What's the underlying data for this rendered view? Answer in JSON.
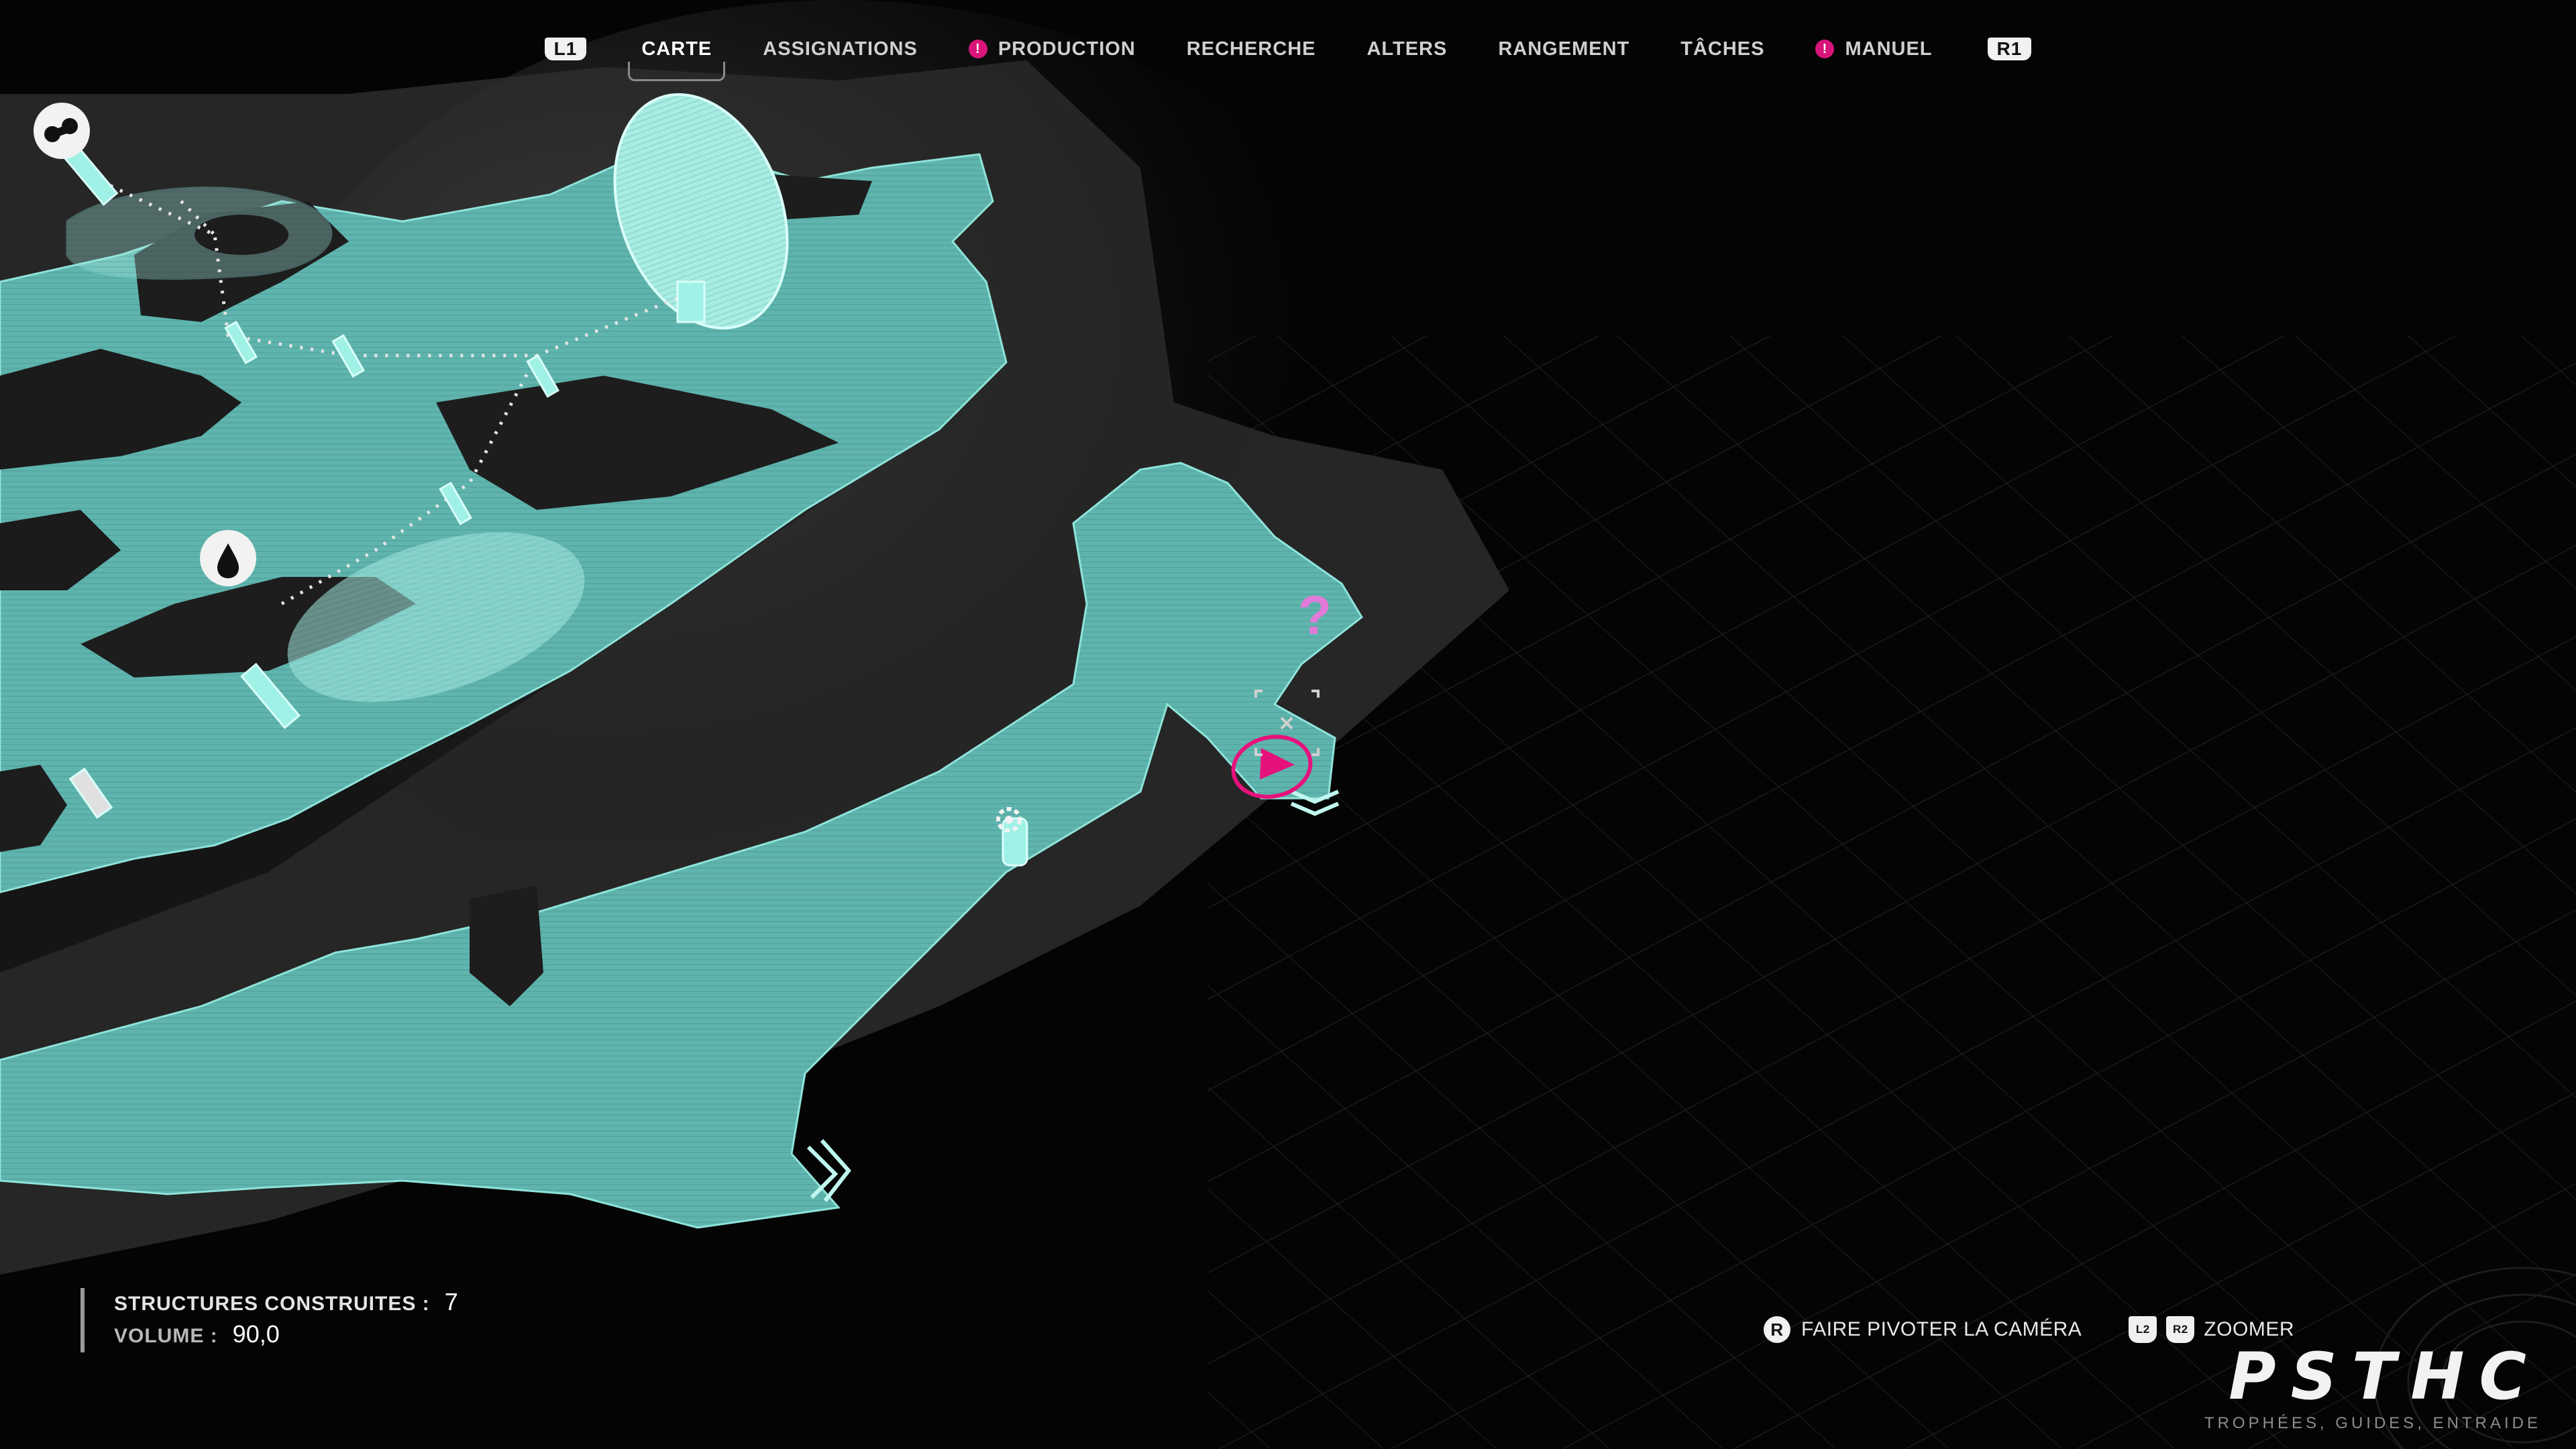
{
  "nav": {
    "left_button": "L1",
    "right_button": "R1",
    "tabs": [
      {
        "label": "CARTE",
        "active": true,
        "alert": false
      },
      {
        "label": "ASSIGNATIONS",
        "active": false,
        "alert": false
      },
      {
        "label": "PRODUCTION",
        "active": false,
        "alert": true
      },
      {
        "label": "RECHERCHE",
        "active": false,
        "alert": false
      },
      {
        "label": "ALTERS",
        "active": false,
        "alert": false
      },
      {
        "label": "RANGEMENT",
        "active": false,
        "alert": false
      },
      {
        "label": "TÂCHES",
        "active": false,
        "alert": false
      },
      {
        "label": "MANUEL",
        "active": false,
        "alert": true
      }
    ],
    "alert_glyph": "!"
  },
  "stats": {
    "structures_label": "STRUCTURES CONSTRUITES :",
    "structures_value": "7",
    "volume_label": "VOLUME :",
    "volume_value": "90,0"
  },
  "controls": {
    "rotate_button": "R",
    "rotate_label": "FAIRE PIVOTER LA CAMÉRA",
    "zoom_button_1": "L2",
    "zoom_button_2": "R2",
    "zoom_label": "ZOOMER"
  },
  "map": {
    "unknown_marker": "?",
    "land_color": "#5fb5ae",
    "marker_color": "#e6127c",
    "unknown_color": "#e27ad9"
  },
  "watermark": {
    "title": "PSTHC",
    "subtitle": "TROPHÉES, GUIDES, ENTRAIDE"
  }
}
